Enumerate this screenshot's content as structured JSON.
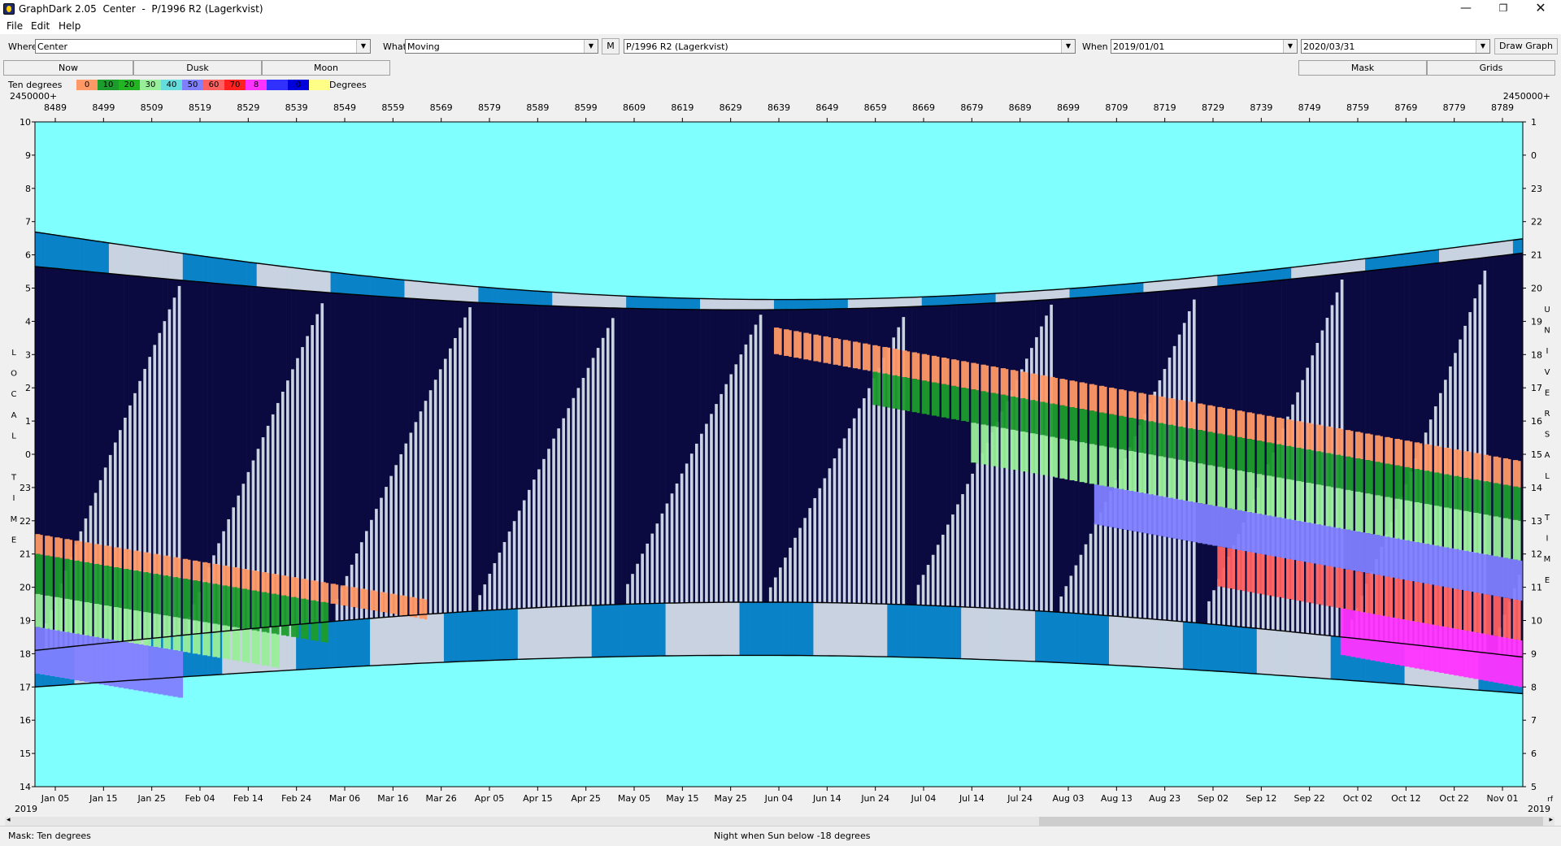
{
  "window": {
    "title": "GraphDark 2.05  Center  -  P/1996 R2 (Lagerkvist)",
    "minimize": "—",
    "maximize": "❐",
    "close": "✕"
  },
  "menu": [
    "File",
    "Edit",
    "Help"
  ],
  "toolbar": {
    "where_label": "Where",
    "where_value": "Center",
    "what_label": "What",
    "what_value": "Moving",
    "m_button": "M",
    "object_value": "P/1996 R2 (Lagerkvist)",
    "when_label": "When",
    "when_start": "2019/01/01",
    "when_end": "2020/03/31",
    "draw_button": "Draw Graph"
  },
  "buttons": {
    "now": "Now",
    "dusk": "Dusk",
    "moon": "Moon",
    "mask": "Mask",
    "grids": "Grids"
  },
  "legend": {
    "label": "Ten degrees",
    "unit": "Degrees",
    "steps": [
      {
        "text": "0",
        "color": "#ff9966"
      },
      {
        "text": "10",
        "color": "#1c9c2c"
      },
      {
        "text": "20",
        "color": "#22b422"
      },
      {
        "text": "30",
        "color": "#99ee99"
      },
      {
        "text": "40",
        "color": "#66dddd"
      },
      {
        "text": "50",
        "color": "#8080ff"
      },
      {
        "text": "60",
        "color": "#ff6060"
      },
      {
        "text": "70",
        "color": "#ff2020"
      },
      {
        "text": "8",
        "color": "#ff33ff"
      },
      {
        "text": "",
        "color": "#3030ff"
      },
      {
        "text": "0",
        "color": "#0000dd"
      },
      {
        "text": "",
        "color": "#ffff88"
      }
    ]
  },
  "graph": {
    "jd_prefix_left": "2450000+",
    "jd_prefix_right": "2450000+",
    "jd_ticks": [
      "8489",
      "8499",
      "8509",
      "8519",
      "8529",
      "8539",
      "8549",
      "8559",
      "8569",
      "8579",
      "8589",
      "8599",
      "8609",
      "8619",
      "8629",
      "8639",
      "8649",
      "8659",
      "8669",
      "8679",
      "8689",
      "8699",
      "8709",
      "8719",
      "8729",
      "8739",
      "8749",
      "8759",
      "8769",
      "8779",
      "8789"
    ],
    "date_ticks": [
      "Jan 05",
      "Jan 15",
      "Jan 25",
      "Feb 04",
      "Feb 14",
      "Feb 24",
      "Mar 06",
      "Mar 16",
      "Mar 26",
      "Apr 05",
      "Apr 15",
      "Apr 25",
      "May 05",
      "May 15",
      "May 25",
      "Jun 04",
      "Jun 14",
      "Jun 24",
      "Jul 04",
      "Jul 14",
      "Jul 24",
      "Aug 03",
      "Aug 13",
      "Aug 23",
      "Sep 02",
      "Sep 12",
      "Sep 22",
      "Oct 02",
      "Oct 12",
      "Oct 22",
      "Nov 01"
    ],
    "year_left": "2019",
    "year_right": "2019",
    "rf": "rf",
    "left_axis_title": [
      "L",
      "O",
      "C",
      "A",
      "L",
      "",
      "T",
      "I",
      "M",
      "E"
    ],
    "right_axis_title": [
      "U",
      "N",
      "I",
      "V",
      "E",
      "R",
      "S",
      "A",
      "L",
      "",
      "T",
      "I",
      "M",
      "E"
    ],
    "left_hours": [
      "10",
      "9",
      "8",
      "7",
      "6",
      "5",
      "4",
      "3",
      "2",
      "1",
      "0",
      "23",
      "22",
      "21",
      "20",
      "19",
      "18",
      "17",
      "16",
      "15",
      "14"
    ],
    "right_hours": [
      "1",
      "0",
      "23",
      "22",
      "21",
      "20",
      "19",
      "18",
      "17",
      "16",
      "15",
      "14",
      "13",
      "12",
      "11",
      "10",
      "9",
      "8",
      "7",
      "6",
      "5"
    ],
    "colors": {
      "day": "#80ffff",
      "night": "#0a0a40",
      "moon": "#c8d2e0",
      "twilight": "#0a82c8"
    }
  },
  "status": {
    "left": "Mask:  Ten degrees",
    "center": "Night when Sun below -18 degrees"
  }
}
